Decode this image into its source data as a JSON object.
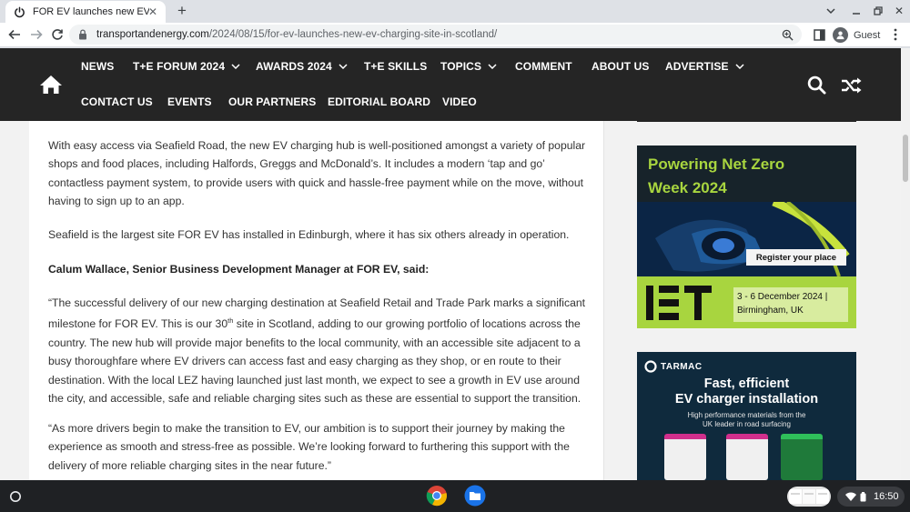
{
  "browser": {
    "tab_title": "FOR EV launches new EV chargi",
    "url_host": "transportandenergy.com",
    "url_path": "/2024/08/15/for-ev-launches-new-ev-charging-site-in-scotland/",
    "profile_name": "Guest"
  },
  "site": {
    "nav_row1": [
      {
        "label": "NEWS",
        "dropdown": false
      },
      {
        "label": "T+E FORUM 2024",
        "dropdown": true
      },
      {
        "label": "AWARDS 2024",
        "dropdown": true
      },
      {
        "label": "T+E SKILLS",
        "dropdown": false
      },
      {
        "label": "TOPICS",
        "dropdown": true
      },
      {
        "label": "COMMENT",
        "dropdown": false
      },
      {
        "label": "ABOUT US",
        "dropdown": false
      },
      {
        "label": "ADVERTISE",
        "dropdown": true
      }
    ],
    "nav_row2": [
      {
        "label": "CONTACT US"
      },
      {
        "label": "EVENTS"
      },
      {
        "label": "OUR PARTNERS"
      },
      {
        "label": "EDITORIAL BOARD"
      },
      {
        "label": "VIDEO"
      }
    ]
  },
  "article": {
    "p1": "With easy access via Seafield Road, the new EV charging hub is well-positioned amongst a variety of popular shops and food places, including Halfords, Greggs and McDonald’s. It includes a modern ‘tap and go’ contactless payment system, to provide users with quick and hassle-free payment while on the move, without having to sign up to an app.",
    "p2": "Seafield is the largest site FOR EV has installed in Edinburgh, where it has six others already in operation.",
    "p3": "Calum Wallace, Senior Business Development Manager at FOR EV, said:",
    "p4_a": "“The successful delivery of our new charging destination at Seafield Retail and Trade Park marks a significant milestone for FOR EV. This is our 30",
    "p4_sup": "th",
    "p4_b": " site in Scotland, adding to our growing portfolio of locations across the country. The new hub will provide major benefits to the local community, with an accessible site adjacent to a busy thoroughfare where EV drivers can access fast and easy charging as they shop, or en route to their destination. With the local LEZ having launched just last month, we expect to see a growth in EV use around the city, and accessible, safe and reliable charging sites such as these are essential to support the transition.",
    "p5": "“As more drivers begin to make the transition to EV, our ambition is to support their journey by making the experience as smooth and stress-free as possible. We’re looking forward to furthering this support with the delivery of more reliable charging sites in the near future.”"
  },
  "ad1": {
    "headline_l1": "Powering Net Zero",
    "headline_l2": "Week 2024",
    "register": "Register your place",
    "date_l1": "3 - 6 December 2024 |",
    "date_l2": "Birmingham, UK"
  },
  "ad2": {
    "brand": "TARMAC",
    "headline_l1": "Fast, efficient",
    "headline_l2": "EV charger installation",
    "sub_l1": "High performance materials from the",
    "sub_l2": "UK leader in road surfacing"
  },
  "shelf": {
    "clock": "16:50"
  },
  "colors": {
    "site_header": "#252525",
    "ad_green": "#a8d53f"
  }
}
